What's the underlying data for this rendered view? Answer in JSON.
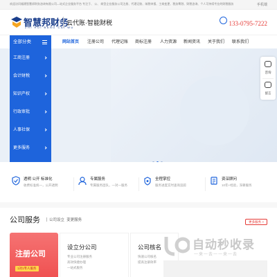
{
  "topbar": {
    "text": "欢迎访问福建智慧邦财务咨询有限公司—站式企业服务平台 专注于、 公、 商型企业服务公司注册、代理记账、纳税申报、工商变更、税务筹划、财税咨询、个人可持续专业的财税服务",
    "mobile": "手机端"
  },
  "header": {
    "logo_cn": "智慧邦财务",
    "logo_py": "ZHI HUI BANG CAI WU",
    "slogan": "云代账·智能财税",
    "phone": "133-0795-7222"
  },
  "nav": {
    "all_categories": "全部分类",
    "items": [
      "网站首页",
      "注册公司",
      "代理记账",
      "商标注册",
      "人力资源",
      "新闻资讯",
      "关于我们",
      "联系我们"
    ]
  },
  "side_menu": [
    "工商注册",
    "会计财税",
    "知识产权",
    "行政审批",
    "人事社保",
    "更多服务"
  ],
  "floater": {
    "item1": "咨询",
    "item2": "留言"
  },
  "features": [
    {
      "title": "透明 公开 标准化",
      "desc": "收费标准统一，公开透明"
    },
    {
      "title": "专属服务",
      "desc": "专属服务团队，一对一服务"
    },
    {
      "title": "全程掌控",
      "desc": "服务进度实时查询追踪"
    },
    {
      "title": "资深顾问",
      "desc": "10年+经验，深耕服务"
    }
  ],
  "section": {
    "title": "公司服务",
    "sub1": "公司设立",
    "sub2": "变更服务",
    "more": "更多服务 >"
  },
  "services": {
    "red_title": "注册公司",
    "red_tag": "1对1专人服务",
    "card1_title": "设立分公司",
    "card1_d1": "专业公司注册服务",
    "card1_d2": "高效快捷办理",
    "card1_d3": "一站式服务",
    "card2_title": "公司核名",
    "card2_d1": "快速公司核名",
    "card2_d2": "提高注册效率"
  },
  "watermark": {
    "title": "自动秒收录",
    "sub": "一来一去一一来一去"
  },
  "colors": {
    "primary": "#1e64dc",
    "accent_red": "#ef4e4e",
    "phone": "#e53935",
    "logo": "#1a3e8c"
  }
}
